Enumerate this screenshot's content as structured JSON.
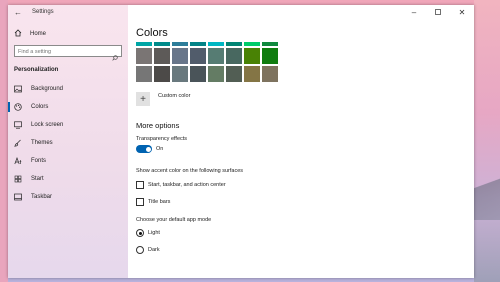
{
  "window": {
    "title": "Settings",
    "controls": [
      "minimize",
      "maximize",
      "close"
    ]
  },
  "sidebar": {
    "home_label": "Home",
    "search_placeholder": "Find a setting",
    "section_label": "Personalization",
    "items": [
      {
        "label": "Background",
        "icon": "picture-icon",
        "active": false
      },
      {
        "label": "Colors",
        "icon": "palette-icon",
        "active": true
      },
      {
        "label": "Lock screen",
        "icon": "lock-screen-icon",
        "active": false
      },
      {
        "label": "Themes",
        "icon": "brush-icon",
        "active": false
      },
      {
        "label": "Fonts",
        "icon": "font-icon",
        "active": false
      },
      {
        "label": "Start",
        "icon": "start-icon",
        "active": false
      },
      {
        "label": "Taskbar",
        "icon": "taskbar-icon",
        "active": false
      }
    ]
  },
  "main": {
    "heading": "Colors",
    "swatch_colors": {
      "top_strip": [
        "#00a6a6",
        "#008b8b",
        "#2d7d9a",
        "#038387",
        "#00b7c3",
        "#018574",
        "#00cc6a",
        "#10893e"
      ],
      "row1": [
        "#7a7574",
        "#5d5a58",
        "#68768a",
        "#515c6b",
        "#567c73",
        "#486860",
        "#498205",
        "#107c10"
      ],
      "row2": [
        "#767676",
        "#4c4a48",
        "#69797e",
        "#4a5459",
        "#647c64",
        "#525e54",
        "#847545",
        "#7e735f"
      ]
    },
    "custom_color_label": "Custom color",
    "more_options_heading": "More options",
    "transparency_label": "Transparency effects",
    "transparency_state": "On",
    "accent_surfaces_label": "Show accent color on the following surfaces",
    "accent_checkboxes": [
      {
        "label": "Start, taskbar, and action center",
        "checked": false
      },
      {
        "label": "Title bars",
        "checked": false
      }
    ],
    "app_mode_label": "Choose your default app mode",
    "app_modes": [
      {
        "label": "Light",
        "selected": true
      },
      {
        "label": "Dark",
        "selected": false
      }
    ]
  },
  "colors": {
    "accent": "#0063b1"
  }
}
